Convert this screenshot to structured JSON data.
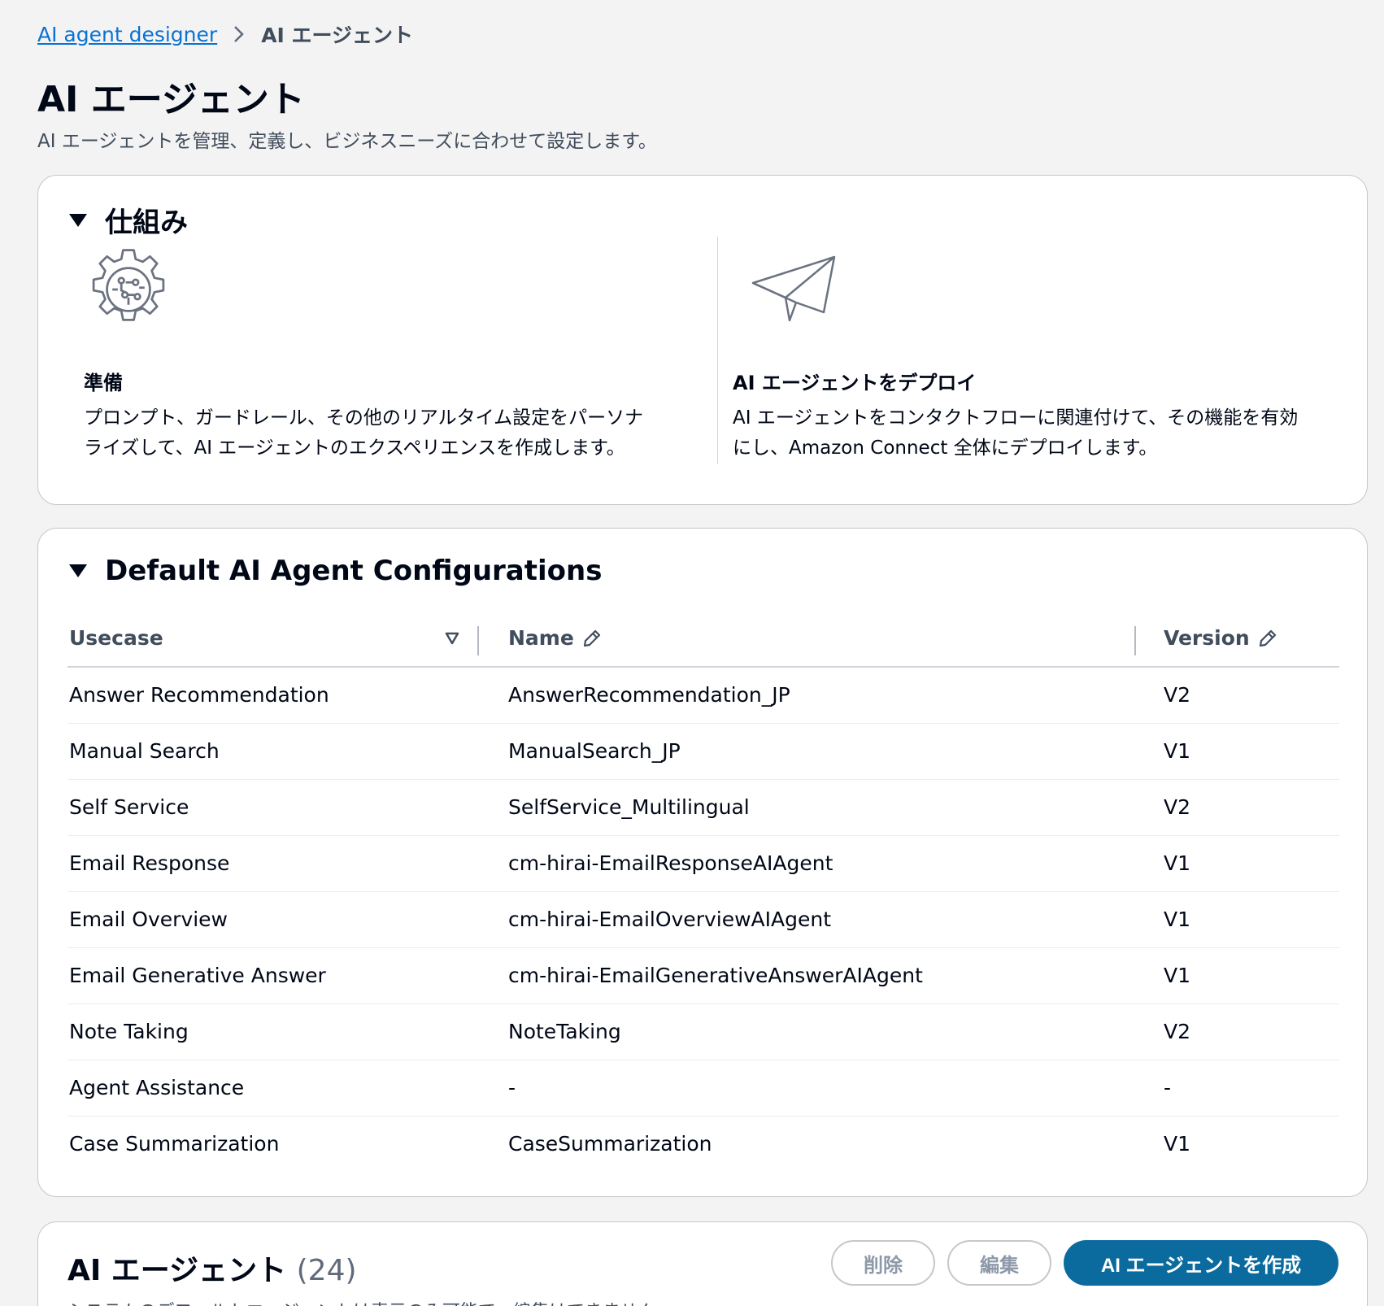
{
  "breadcrumb": {
    "parent": "AI agent designer",
    "current": "AI エージェント"
  },
  "page": {
    "title": "AI エージェント",
    "description": "AI エージェントを管理、定義し、ビジネスニーズに合わせて設定します。"
  },
  "how_it_works": {
    "title": "仕組み",
    "steps": [
      {
        "icon": "gear-circuit-icon",
        "title": "準備",
        "text_line1": "プロンプト、ガードレール、その他のリアルタイム設定をパーソナ",
        "text_line2": "ライズして、AI エージェントのエクスペリエンスを作成します。"
      },
      {
        "icon": "paper-plane-icon",
        "title": "AI エージェントをデプロイ",
        "text_line1": "AI エージェントをコンタクトフローに関連付けて、その機能を有効",
        "text_line2": "にし、Amazon Connect 全体にデプロイします。"
      }
    ]
  },
  "default_configs": {
    "title": "Default AI Agent Configurations",
    "columns": {
      "usecase": "Usecase",
      "name": "Name",
      "version": "Version"
    },
    "rows": [
      {
        "usecase": "Answer Recommendation",
        "name": "AnswerRecommendation_JP",
        "version": "V2"
      },
      {
        "usecase": "Manual Search",
        "name": "ManualSearch_JP",
        "version": "V1"
      },
      {
        "usecase": "Self Service",
        "name": "SelfService_Multilingual",
        "version": "V2"
      },
      {
        "usecase": "Email Response",
        "name": "cm-hirai-EmailResponseAIAgent",
        "version": "V1"
      },
      {
        "usecase": "Email Overview",
        "name": "cm-hirai-EmailOverviewAIAgent",
        "version": "V1"
      },
      {
        "usecase": "Email Generative Answer",
        "name": "cm-hirai-EmailGenerativeAnswerAIAgent",
        "version": "V1"
      },
      {
        "usecase": "Note Taking",
        "name": "NoteTaking",
        "version": "V2"
      },
      {
        "usecase": "Agent Assistance",
        "name": "-",
        "version": "-"
      },
      {
        "usecase": "Case Summarization",
        "name": "CaseSummarization",
        "version": "V1"
      }
    ]
  },
  "agents": {
    "title": "AI エージェント",
    "count": "(24)",
    "description": "システムのデフォルトエージェントは表示のみ可能で、編集はできません。",
    "buttons": {
      "delete": "削除",
      "edit": "編集",
      "create": "AI エージェントを作成"
    }
  }
}
